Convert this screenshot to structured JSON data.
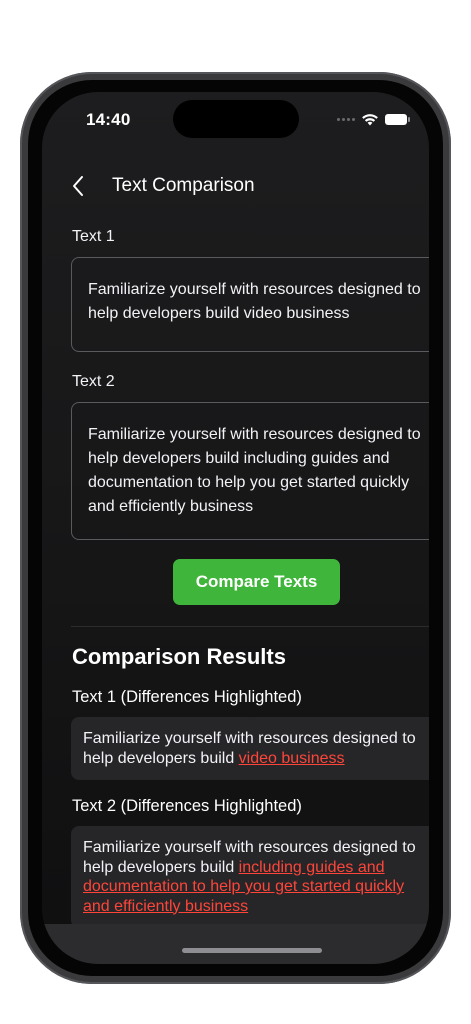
{
  "status": {
    "time": "14:40"
  },
  "nav": {
    "title": "Text Comparison"
  },
  "text1": {
    "label": "Text 1",
    "value": "Familiarize yourself with resources designed to help developers build video business"
  },
  "text2": {
    "label": "Text 2",
    "value": "Familiarize yourself with resources designed to help developers build including guides and documentation to help you get started quickly and efficiently business"
  },
  "compare_button": {
    "label": "Compare Texts",
    "color": "#40b53b"
  },
  "results": {
    "title": "Comparison Results",
    "text1_heading": "Text 1 (Differences Highlighted)",
    "text1_common": "Familiarize yourself with resources designed to help developers build ",
    "text1_diff": "video business",
    "text2_heading": "Text 2 (Differences Highlighted)",
    "text2_common": "Familiarize yourself with resources designed to help developers build ",
    "text2_diff": "including guides and documentation to help you get started quickly and efficiently business",
    "highlight_color": "#ff453a"
  },
  "icons": [
    "back-chevron-icon",
    "wifi-icon",
    "battery-icon",
    "signal-icon"
  ]
}
